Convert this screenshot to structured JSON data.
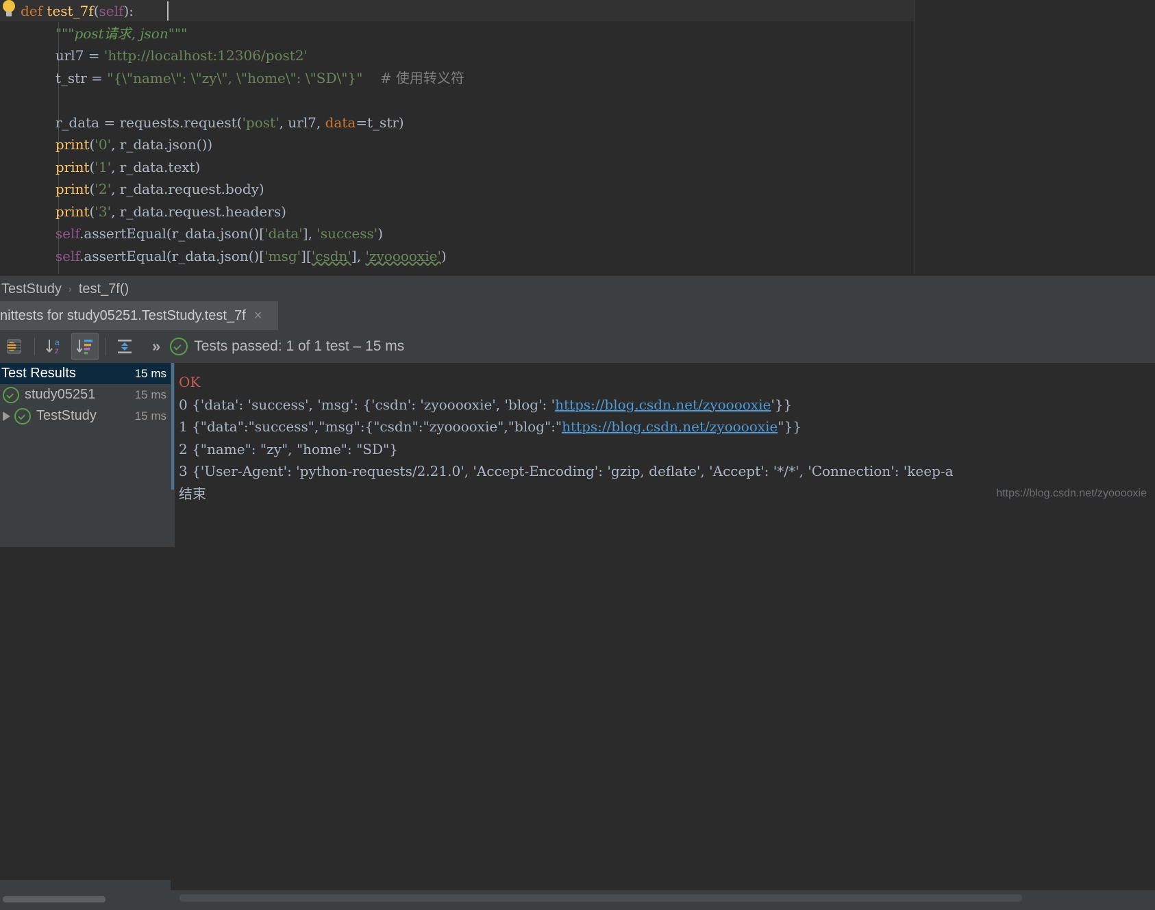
{
  "editor": {
    "gutter_icon": "lightbulb-icon",
    "lines": [
      {
        "id": "l1",
        "indent": 0,
        "tokens": [
          {
            "t": "def ",
            "c": "kw"
          },
          {
            "t": "test_7f",
            "c": "fn"
          },
          {
            "t": "(",
            "c": "punc"
          },
          {
            "t": "self",
            "c": "self"
          },
          {
            "t": "):",
            "c": "punc"
          }
        ]
      },
      {
        "id": "l2",
        "indent": 4,
        "tokens": [
          {
            "t": "\"\"\"post请求, json\"\"\"",
            "c": "doc"
          }
        ]
      },
      {
        "id": "l3",
        "indent": 4,
        "tokens": [
          {
            "t": "url7 = ",
            "c": "id"
          },
          {
            "t": "'http://localhost:12306/post2'",
            "c": "str"
          }
        ]
      },
      {
        "id": "l4",
        "indent": 4,
        "tokens": [
          {
            "t": "t_str = ",
            "c": "id"
          },
          {
            "t": "\"{\\\"name\\\": \\\"zy\\\", \\\"home\\\": \\\"SD\\\"}\"",
            "c": "str"
          },
          {
            "t": "    # 使用转义符",
            "c": "cmt"
          }
        ]
      },
      {
        "id": "l5",
        "indent": 0,
        "tokens": []
      },
      {
        "id": "l6",
        "indent": 4,
        "tokens": [
          {
            "t": "r_data = requests.request(",
            "c": "id"
          },
          {
            "t": "'post'",
            "c": "str"
          },
          {
            "t": ", url7, ",
            "c": "id"
          },
          {
            "t": "data",
            "c": "param"
          },
          {
            "t": "=t_str)",
            "c": "id"
          }
        ]
      },
      {
        "id": "l7",
        "indent": 4,
        "tokens": [
          {
            "t": "print",
            "c": "fncall"
          },
          {
            "t": "(",
            "c": "punc"
          },
          {
            "t": "'0'",
            "c": "str"
          },
          {
            "t": ", r_data.json())",
            "c": "id"
          }
        ]
      },
      {
        "id": "l8",
        "indent": 4,
        "tokens": [
          {
            "t": "print",
            "c": "fncall"
          },
          {
            "t": "(",
            "c": "punc"
          },
          {
            "t": "'1'",
            "c": "str"
          },
          {
            "t": ", r_data.text)",
            "c": "id"
          }
        ]
      },
      {
        "id": "l9",
        "indent": 4,
        "tokens": [
          {
            "t": "print",
            "c": "fncall"
          },
          {
            "t": "(",
            "c": "punc"
          },
          {
            "t": "'2'",
            "c": "str"
          },
          {
            "t": ", r_data.request.body)",
            "c": "id"
          }
        ]
      },
      {
        "id": "l10",
        "indent": 4,
        "tokens": [
          {
            "t": "print",
            "c": "fncall"
          },
          {
            "t": "(",
            "c": "punc"
          },
          {
            "t": "'3'",
            "c": "str"
          },
          {
            "t": ", r_data.request.headers)",
            "c": "id"
          }
        ]
      },
      {
        "id": "l11",
        "indent": 4,
        "tokens": [
          {
            "t": "self",
            "c": "self"
          },
          {
            "t": ".assertEqual(r_data.json()[",
            "c": "id"
          },
          {
            "t": "'data'",
            "c": "str"
          },
          {
            "t": "], ",
            "c": "id"
          },
          {
            "t": "'success'",
            "c": "str"
          },
          {
            "t": ")",
            "c": "id"
          }
        ]
      },
      {
        "id": "l12",
        "indent": 4,
        "tokens": [
          {
            "t": "self",
            "c": "self"
          },
          {
            "t": ".assertEqual(r_data.json()[",
            "c": "id"
          },
          {
            "t": "'msg'",
            "c": "str"
          },
          {
            "t": "][",
            "c": "id"
          },
          {
            "t": "'csdn'",
            "c": "str-typo"
          },
          {
            "t": "], ",
            "c": "id"
          },
          {
            "t": "'zyooooxie'",
            "c": "str-typo"
          },
          {
            "t": ")",
            "c": "id"
          }
        ]
      }
    ]
  },
  "breadcrumb": {
    "items": [
      "TestStudy",
      "test_7f()"
    ],
    "separator": "›"
  },
  "tab": {
    "label": "nittests for study05251.TestStudy.test_7f",
    "close_glyph": "×"
  },
  "toolbar": {
    "buttons": [
      {
        "name": "export-test-results-button",
        "icon": "export-icon",
        "selected": false
      },
      {
        "name": "sort-alphabetically-button",
        "icon": "sort-alphabetically-icon",
        "selected": false
      },
      {
        "name": "sort-by-duration-button",
        "icon": "sort-by-duration-icon",
        "selected": true
      },
      {
        "name": "expand-collapse-button",
        "icon": "expand-collapse-icon",
        "selected": false
      }
    ],
    "overflow_glyph": "»",
    "status_icon": "test-passed-check-icon",
    "status_text": "Tests passed: 1 of 1 test – 15 ms"
  },
  "test_tree": {
    "rows": [
      {
        "label": "Test Results",
        "duration": "15 ms",
        "icon": "none",
        "arrow": false,
        "level": 0,
        "selected": true
      },
      {
        "label": "study05251",
        "duration": "15 ms",
        "icon": "test-passed-icon",
        "arrow": false,
        "level": 0,
        "selected": false
      },
      {
        "label": "TestStudy",
        "duration": "15 ms",
        "icon": "test-passed-icon",
        "arrow": true,
        "level": 1,
        "selected": false
      }
    ]
  },
  "console": {
    "lines": [
      {
        "id": "c0",
        "parts": [
          {
            "t": "OK",
            "c": "red"
          }
        ]
      },
      {
        "id": "c1",
        "parts": [
          {
            "t": "0 {'data': 'success', 'msg': {'csdn': 'zyooooxie', 'blog': '",
            "c": "plain"
          },
          {
            "t": "https://blog.csdn.net/zyooooxie",
            "c": "link"
          },
          {
            "t": "'}}",
            "c": "plain"
          }
        ]
      },
      {
        "id": "c2",
        "parts": [
          {
            "t": "1 {\"data\":\"success\",\"msg\":{\"csdn\":\"zyooooxie\",\"blog\":\"",
            "c": "plain"
          },
          {
            "t": "https://blog.csdn.net/zyooooxie",
            "c": "link"
          },
          {
            "t": "\"}}",
            "c": "plain"
          }
        ]
      },
      {
        "id": "c3",
        "parts": [
          {
            "t": "2 {\"name\": \"zy\", \"home\": \"SD\"}",
            "c": "plain"
          }
        ]
      },
      {
        "id": "c4",
        "parts": [
          {
            "t": "3 {'User-Agent': 'python-requests/2.21.0', 'Accept-Encoding': 'gzip, deflate', 'Accept': '*/*', 'Connection': 'keep-a",
            "c": "plain"
          }
        ]
      },
      {
        "id": "c5",
        "parts": [
          {
            "t": "结束",
            "c": "plain"
          }
        ]
      }
    ]
  },
  "watermark": {
    "text": "https://blog.csdn.net/zyooooxie"
  },
  "colors": {
    "editor_bg": "#2b2b2b",
    "panel_bg": "#3c3f41",
    "keyword": "#cc7832",
    "function": "#ffc66d",
    "string": "#6a8759",
    "self": "#94558d",
    "comment": "#808080",
    "doc": "#629755",
    "link": "#519ad6",
    "error": "#cf5b56",
    "pass_green": "#5a9e4b",
    "selection_blue": "#0d293e"
  }
}
